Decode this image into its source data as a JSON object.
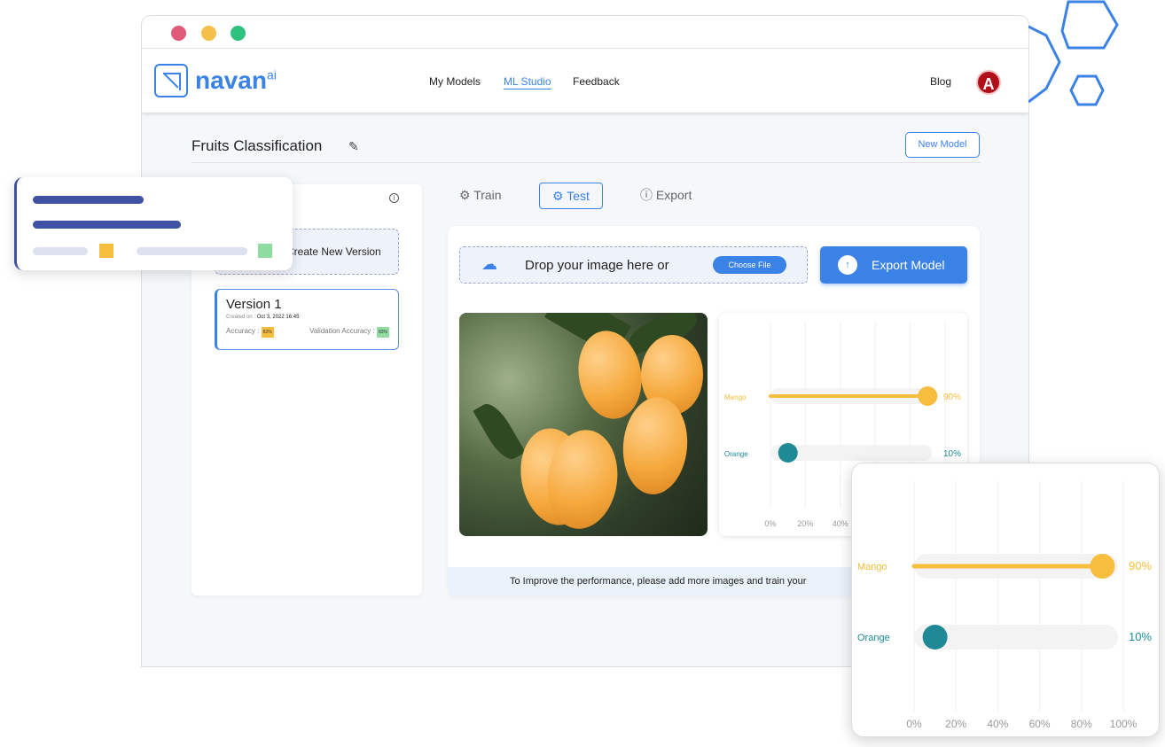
{
  "window": {
    "dots": [
      "#e05a7a",
      "#f4c04a",
      "#2ec27e"
    ]
  },
  "nav": {
    "brand": "navan",
    "brand_sup": "ai",
    "links": [
      "My Models",
      "ML Studio",
      "Feedback"
    ],
    "active": "ML Studio",
    "blog": "Blog",
    "avatar": "A"
  },
  "page": {
    "title": "Fruits Classification",
    "new_model": "New Model"
  },
  "versions": {
    "create_label": "Create New Version",
    "items": [
      {
        "name": "Version 1",
        "created_label": "Created on :",
        "created": "Oct 3, 2022  16:45",
        "accuracy_label": "Accuracy :",
        "accuracy": "83%",
        "val_label": "Validation Accuracy :",
        "val_accuracy": "83%"
      }
    ]
  },
  "tabs": [
    {
      "label": "Train",
      "icon": "gear-icon"
    },
    {
      "label": "Test",
      "icon": "gear-icon"
    },
    {
      "label": "Export",
      "icon": "export-icon"
    }
  ],
  "upload": {
    "text": "Drop your image here or",
    "choose": "Choose File"
  },
  "export_button": "Export Model",
  "notice": "To Improve the performance, please add more images and train your",
  "colors": {
    "accent": "#3b82e6",
    "mango": "#f7bd3c",
    "orange": "#1f8a96"
  },
  "chart_data": {
    "type": "bar",
    "categories": [
      "Mango",
      "Orange"
    ],
    "values": [
      90,
      10
    ],
    "value_labels": [
      "90%",
      "10%"
    ],
    "xticks": [
      "0%",
      "20%",
      "40%",
      "60%",
      "80%",
      "100%"
    ],
    "xlim": [
      0,
      100
    ],
    "grid": true
  }
}
